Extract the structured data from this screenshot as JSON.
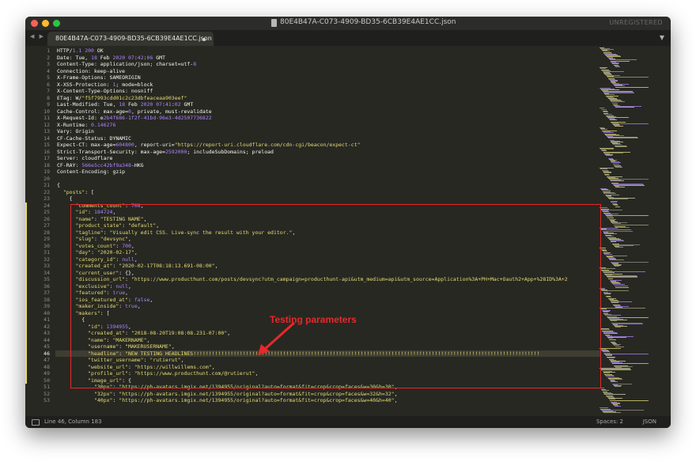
{
  "window": {
    "title": "80E4B47A-C073-4909-BD35-6CB39E4AE1CC.json",
    "unregistered_label": "UNREGISTERED",
    "nav_arrows": "◀ ▶"
  },
  "tab": {
    "label": "80E4B47A-C073-4909-BD35-6CB39E4AE1CC.json",
    "menu_glyph": "▼"
  },
  "editor": {
    "current_line": 46,
    "modified_lines": [
      24,
      25,
      26,
      27,
      28,
      29,
      30,
      31,
      32,
      33,
      34,
      35,
      36,
      37,
      38,
      39,
      40,
      41,
      42,
      43,
      44,
      45,
      46,
      47,
      48,
      49,
      50
    ],
    "lines": [
      [
        [
          "HTTP/",
          "#f8f8f2"
        ],
        [
          "1.1 200",
          "#ae81ff"
        ],
        [
          " OK",
          "#f8f8f2"
        ]
      ],
      [
        [
          "Date: Tue, ",
          "#f8f8f2"
        ],
        [
          "18",
          "#ae81ff"
        ],
        [
          " Feb ",
          "#f8f8f2"
        ],
        [
          "2020 07",
          "#ae81ff"
        ],
        [
          ":",
          "#f8f8f2"
        ],
        [
          "42",
          "#ae81ff"
        ],
        [
          ":",
          "#f8f8f2"
        ],
        [
          "06",
          "#ae81ff"
        ],
        [
          " GMT",
          "#f8f8f2"
        ]
      ],
      [
        [
          "Content-Type: application/json; charset=utf-",
          "#f8f8f2"
        ],
        [
          "8",
          "#ae81ff"
        ]
      ],
      [
        [
          "Connection: keep-alive",
          "#f8f8f2"
        ]
      ],
      [
        [
          "X-Frame-Options: SAMEORIGIN",
          "#f8f8f2"
        ]
      ],
      [
        [
          "X-XSS-Protection: ",
          "#f8f8f2"
        ],
        [
          "1",
          "#ae81ff"
        ],
        [
          "; mode=block",
          "#f8f8f2"
        ]
      ],
      [
        [
          "X-Content-Type-Options: nosniff",
          "#f8f8f2"
        ]
      ],
      [
        [
          "ETag: W/",
          "#f8f8f2"
        ],
        [
          "\"f5f7993cdd01c2c23dbfeaceaa903eef\"",
          "#e6db74"
        ]
      ],
      [
        [
          "Last-Modified: Tue, ",
          "#f8f8f2"
        ],
        [
          "18",
          "#ae81ff"
        ],
        [
          " Feb ",
          "#f8f8f2"
        ],
        [
          "2020 07",
          "#ae81ff"
        ],
        [
          ":",
          "#f8f8f2"
        ],
        [
          "41",
          "#ae81ff"
        ],
        [
          ":",
          "#f8f8f2"
        ],
        [
          "02",
          "#ae81ff"
        ],
        [
          " GMT",
          "#f8f8f2"
        ]
      ],
      [
        [
          "Cache-Control: max-age=",
          "#f8f8f2"
        ],
        [
          "0",
          "#ae81ff"
        ],
        [
          ", private, must-revalidate",
          "#f8f8f2"
        ]
      ],
      [
        [
          "X-Request-Id: e",
          "#f8f8f2"
        ],
        [
          "2b4f686-1f2f-41bd-96e3-4d2507736822",
          "#ae81ff"
        ]
      ],
      [
        [
          "X-Runtime: ",
          "#f8f8f2"
        ],
        [
          "0.146276",
          "#ae81ff"
        ]
      ],
      [
        [
          "Vary: Origin",
          "#f8f8f2"
        ]
      ],
      [
        [
          "CF-Cache-Status: DYNAMIC",
          "#f8f8f2"
        ]
      ],
      [
        [
          "Expect-CT: max-age=",
          "#f8f8f2"
        ],
        [
          "604800",
          "#ae81ff"
        ],
        [
          ", report-uri=",
          "#f8f8f2"
        ],
        [
          "\"https://report-uri.cloudflare.com/cdn-cgi/beacon/expect-ct\"",
          "#e6db74"
        ]
      ],
      [
        [
          "Strict-Transport-Security: max-age=",
          "#f8f8f2"
        ],
        [
          "2592000",
          "#ae81ff"
        ],
        [
          "; includeSubDomains; preload",
          "#f8f8f2"
        ]
      ],
      [
        [
          "Server: cloudflare",
          "#f8f8f2"
        ]
      ],
      [
        [
          "CF-RAY: ",
          "#f8f8f2"
        ],
        [
          "566e5cc42bf9a348",
          "#ae81ff"
        ],
        [
          "-HKG",
          "#f8f8f2"
        ]
      ],
      [
        [
          "Content-Encoding: gzip",
          "#f8f8f2"
        ]
      ],
      [],
      [
        [
          "{",
          "#f8f8f2"
        ]
      ],
      [
        [
          "  ",
          "#f8f8f2"
        ],
        [
          "\"posts\"",
          "#e6db74"
        ],
        [
          ": [",
          "#f8f8f2"
        ]
      ],
      [
        [
          "    {",
          "#f8f8f2"
        ]
      ],
      [
        [
          "      ",
          "#f8f8f2"
        ],
        [
          "\"comments_count\"",
          "#e6db74"
        ],
        [
          ": ",
          "#f8f8f2"
        ],
        [
          "708",
          "#ae81ff"
        ],
        [
          ",",
          "#f8f8f2"
        ]
      ],
      [
        [
          "      ",
          "#f8f8f2"
        ],
        [
          "\"id\"",
          "#e6db74"
        ],
        [
          ": ",
          "#f8f8f2"
        ],
        [
          "184724",
          "#ae81ff"
        ],
        [
          ",",
          "#f8f8f2"
        ]
      ],
      [
        [
          "      ",
          "#f8f8f2"
        ],
        [
          "\"name\"",
          "#e6db74"
        ],
        [
          ": ",
          "#f8f8f2"
        ],
        [
          "\"TESTING NAME\"",
          "#e6db74"
        ],
        [
          ",",
          "#f8f8f2"
        ]
      ],
      [
        [
          "      ",
          "#f8f8f2"
        ],
        [
          "\"product_state\"",
          "#e6db74"
        ],
        [
          ": ",
          "#f8f8f2"
        ],
        [
          "\"default\"",
          "#e6db74"
        ],
        [
          ",",
          "#f8f8f2"
        ]
      ],
      [
        [
          "      ",
          "#f8f8f2"
        ],
        [
          "\"tagline\"",
          "#e6db74"
        ],
        [
          ": ",
          "#f8f8f2"
        ],
        [
          "\"Visually edit CSS. Live-sync the result with your editor.\"",
          "#e6db74"
        ],
        [
          ",",
          "#f8f8f2"
        ]
      ],
      [
        [
          "      ",
          "#f8f8f2"
        ],
        [
          "\"slug\"",
          "#e6db74"
        ],
        [
          ": ",
          "#f8f8f2"
        ],
        [
          "\"devsync\"",
          "#e6db74"
        ],
        [
          ",",
          "#f8f8f2"
        ]
      ],
      [
        [
          "      ",
          "#f8f8f2"
        ],
        [
          "\"votes_count\"",
          "#e6db74"
        ],
        [
          ": ",
          "#f8f8f2"
        ],
        [
          "700",
          "#ae81ff"
        ],
        [
          ",",
          "#f8f8f2"
        ]
      ],
      [
        [
          "      ",
          "#f8f8f2"
        ],
        [
          "\"day\"",
          "#e6db74"
        ],
        [
          ": ",
          "#f8f8f2"
        ],
        [
          "\"2020-02-17\"",
          "#e6db74"
        ],
        [
          ",",
          "#f8f8f2"
        ]
      ],
      [
        [
          "      ",
          "#f8f8f2"
        ],
        [
          "\"category_id\"",
          "#e6db74"
        ],
        [
          ": ",
          "#f8f8f2"
        ],
        [
          "null",
          "#ae81ff"
        ],
        [
          ",",
          "#f8f8f2"
        ]
      ],
      [
        [
          "      ",
          "#f8f8f2"
        ],
        [
          "\"created_at\"",
          "#e6db74"
        ],
        [
          ": ",
          "#f8f8f2"
        ],
        [
          "\"2020-02-17T08:18:13.691-08:00\"",
          "#e6db74"
        ],
        [
          ",",
          "#f8f8f2"
        ]
      ],
      [
        [
          "      ",
          "#f8f8f2"
        ],
        [
          "\"current_user\"",
          "#e6db74"
        ],
        [
          ": {},",
          "#f8f8f2"
        ]
      ],
      [
        [
          "      ",
          "#f8f8f2"
        ],
        [
          "\"discussion_url\"",
          "#e6db74"
        ],
        [
          ": ",
          "#f8f8f2"
        ],
        [
          "\"https://www.producthunt.com/posts/devsync?utm_campaign=producthunt-api&utm_medium=api&utm_source=Application%3A+PH+Mac+Oauth2+App+%28ID%3A+2",
          "#e6db74"
        ]
      ],
      [
        [
          "      ",
          "#f8f8f2"
        ],
        [
          "\"exclusive\"",
          "#e6db74"
        ],
        [
          ": ",
          "#f8f8f2"
        ],
        [
          "null",
          "#ae81ff"
        ],
        [
          ",",
          "#f8f8f2"
        ]
      ],
      [
        [
          "      ",
          "#f8f8f2"
        ],
        [
          "\"featured\"",
          "#e6db74"
        ],
        [
          ": ",
          "#f8f8f2"
        ],
        [
          "true",
          "#ae81ff"
        ],
        [
          ",",
          "#f8f8f2"
        ]
      ],
      [
        [
          "      ",
          "#f8f8f2"
        ],
        [
          "\"ios_featured_at\"",
          "#e6db74"
        ],
        [
          ": ",
          "#f8f8f2"
        ],
        [
          "false",
          "#ae81ff"
        ],
        [
          ",",
          "#f8f8f2"
        ]
      ],
      [
        [
          "      ",
          "#f8f8f2"
        ],
        [
          "\"maker_inside\"",
          "#e6db74"
        ],
        [
          ": ",
          "#f8f8f2"
        ],
        [
          "true",
          "#ae81ff"
        ],
        [
          ",",
          "#f8f8f2"
        ]
      ],
      [
        [
          "      ",
          "#f8f8f2"
        ],
        [
          "\"makers\"",
          "#e6db74"
        ],
        [
          ": [",
          "#f8f8f2"
        ]
      ],
      [
        [
          "        {",
          "#f8f8f2"
        ]
      ],
      [
        [
          "          ",
          "#f8f8f2"
        ],
        [
          "\"id\"",
          "#e6db74"
        ],
        [
          ": ",
          "#f8f8f2"
        ],
        [
          "1394955",
          "#ae81ff"
        ],
        [
          ",",
          "#f8f8f2"
        ]
      ],
      [
        [
          "          ",
          "#f8f8f2"
        ],
        [
          "\"created_at\"",
          "#e6db74"
        ],
        [
          ": ",
          "#f8f8f2"
        ],
        [
          "\"2018-08-20T19:08:08.231-07:00\"",
          "#e6db74"
        ],
        [
          ",",
          "#f8f8f2"
        ]
      ],
      [
        [
          "          ",
          "#f8f8f2"
        ],
        [
          "\"name\"",
          "#e6db74"
        ],
        [
          ": ",
          "#f8f8f2"
        ],
        [
          "\"MAKERNAME\"",
          "#e6db74"
        ],
        [
          ",",
          "#f8f8f2"
        ]
      ],
      [
        [
          "          ",
          "#f8f8f2"
        ],
        [
          "\"username\"",
          "#e6db74"
        ],
        [
          ": ",
          "#f8f8f2"
        ],
        [
          "\"MAKERUSERNAME\"",
          "#e6db74"
        ],
        [
          ",",
          "#f8f8f2"
        ]
      ],
      [
        [
          "          ",
          "#f8f8f2"
        ],
        [
          "\"headline\"",
          "#e6db74"
        ],
        [
          ": ",
          "#f8f8f2"
        ],
        [
          "\"NEW TESTING HEADLINES!!!!!!!!!!!!!!!!!!!!!!!!!!!!!!!!!!!!!!!!!!!!!!!!!!!!!!!!!!!!!!!!!!!!!!!!!!!!!!!!!!!!!!!!!!!!!!!!!!!!!!!!!!!!!!!!",
          "#e6db74"
        ]
      ],
      [
        [
          "          ",
          "#f8f8f2"
        ],
        [
          "\"twitter_username\"",
          "#e6db74"
        ],
        [
          ": ",
          "#f8f8f2"
        ],
        [
          "\"rutierut\"",
          "#e6db74"
        ],
        [
          ",",
          "#f8f8f2"
        ]
      ],
      [
        [
          "          ",
          "#f8f8f2"
        ],
        [
          "\"website_url\"",
          "#e6db74"
        ],
        [
          ": ",
          "#f8f8f2"
        ],
        [
          "\"https://willwillems.com\"",
          "#e6db74"
        ],
        [
          ",",
          "#f8f8f2"
        ]
      ],
      [
        [
          "          ",
          "#f8f8f2"
        ],
        [
          "\"profile_url\"",
          "#e6db74"
        ],
        [
          ": ",
          "#f8f8f2"
        ],
        [
          "\"https://www.producthunt.com/@rutierut\"",
          "#e6db74"
        ],
        [
          ",",
          "#f8f8f2"
        ]
      ],
      [
        [
          "          ",
          "#f8f8f2"
        ],
        [
          "\"image_url\"",
          "#e6db74"
        ],
        [
          ": {",
          "#f8f8f2"
        ]
      ],
      [
        [
          "            ",
          "#f8f8f2"
        ],
        [
          "\"30px\"",
          "#e6db74"
        ],
        [
          ": ",
          "#f8f8f2"
        ],
        [
          "\"https://ph-avatars.imgix.net/1394955/original?auto=format&fit=crop&crop=faces&w=30&h=30\"",
          "#e6db74"
        ],
        [
          ",",
          "#f8f8f2"
        ]
      ],
      [
        [
          "            ",
          "#f8f8f2"
        ],
        [
          "\"32px\"",
          "#e6db74"
        ],
        [
          ": ",
          "#f8f8f2"
        ],
        [
          "\"https://ph-avatars.imgix.net/1394955/original?auto=format&fit=crop&crop=faces&w=32&h=32\"",
          "#e6db74"
        ],
        [
          ",",
          "#f8f8f2"
        ]
      ],
      [
        [
          "            ",
          "#f8f8f2"
        ],
        [
          "\"40px\"",
          "#e6db74"
        ],
        [
          ": ",
          "#f8f8f2"
        ],
        [
          "\"https://ph-avatars.imgix.net/1394955/original?auto=format&fit=crop&crop=faces&w=40&h=40\"",
          "#e6db74"
        ],
        [
          ",",
          "#f8f8f2"
        ]
      ]
    ]
  },
  "status": {
    "position": "Line 46, Column 183",
    "spaces": "Spaces: 2",
    "syntax": "JSON"
  },
  "annotation": {
    "label": "Testing parameters",
    "color": "#e8282a"
  }
}
